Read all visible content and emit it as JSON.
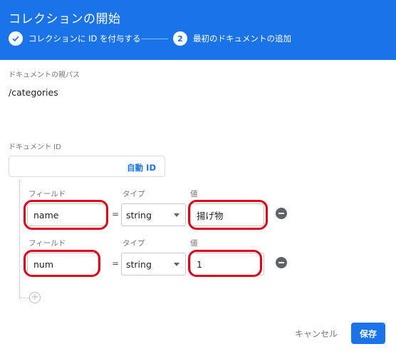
{
  "dialog": {
    "title": "コレクションの開始"
  },
  "steps": [
    {
      "label": "コレクションに ID を付与する",
      "state": "done",
      "icon": "check-icon"
    },
    {
      "number": "2",
      "label": "最初のドキュメントの追加",
      "state": "active"
    }
  ],
  "parent_path": {
    "label": "ドキュメントの親パス",
    "value": "/categories"
  },
  "document_id": {
    "label": "ドキュメント ID",
    "value": "",
    "auto_id_label": "自動 ID"
  },
  "fields": [
    {
      "field_label": "フィールド",
      "type_label": "タイプ",
      "value_label": "値",
      "name": "name",
      "equals": "=",
      "type": "string",
      "value": "揚げ物"
    },
    {
      "field_label": "フィールド",
      "type_label": "タイプ",
      "value_label": "値",
      "name": "num",
      "equals": "=",
      "type": "string",
      "value": "1"
    }
  ],
  "actions": {
    "cancel": "キャンセル",
    "save": "保存"
  },
  "colors": {
    "primary": "#1a73e8",
    "highlight": "#e0001a"
  }
}
